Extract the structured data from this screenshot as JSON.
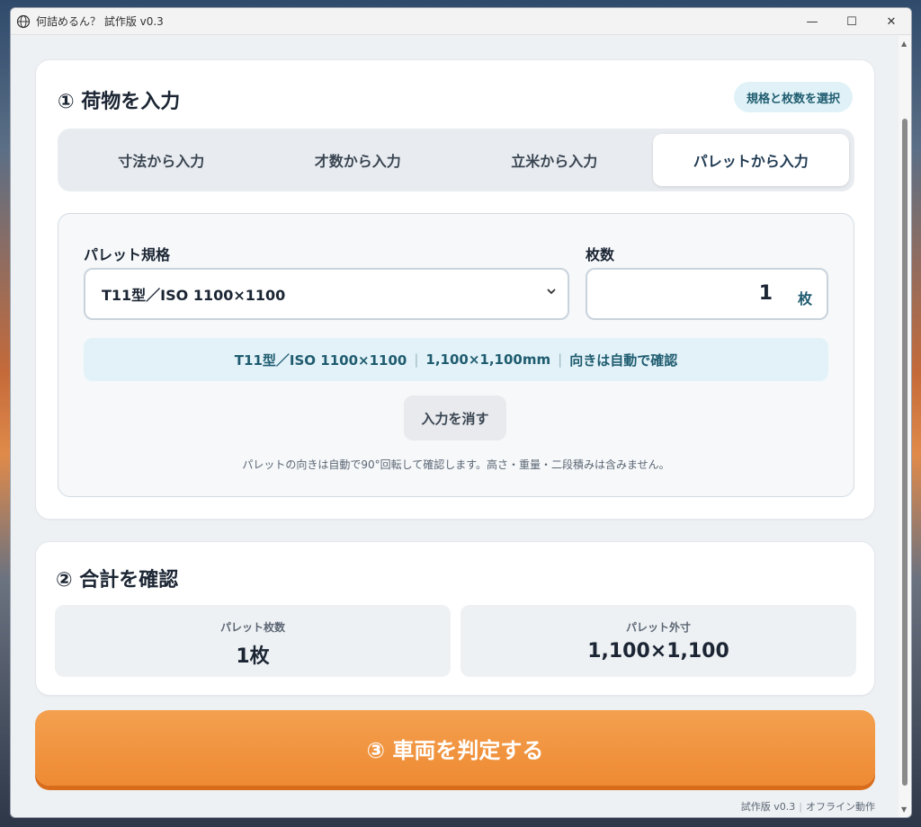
{
  "window": {
    "title": "何詰めるん？ 試作版 v0.3",
    "minimize": "—",
    "maximize": "☐",
    "close": "✕"
  },
  "section1": {
    "title": "① 荷物を入力",
    "chip": "規格と枚数を選択",
    "tabs": [
      {
        "label": "寸法から入力",
        "active": false
      },
      {
        "label": "才数から入力",
        "active": false
      },
      {
        "label": "立米から入力",
        "active": false
      },
      {
        "label": "パレットから入力",
        "active": true
      }
    ],
    "spec_label": "パレット規格",
    "spec_value": "T11型／ISO 1100×1100",
    "count_label": "枚数",
    "count_value": "1",
    "count_unit": "枚",
    "summary": {
      "part1": "T11型／ISO 1100×1100",
      "part2": "1,100×1,100mm",
      "part3": "向きは自動で確認"
    },
    "clear_button": "入力を消す",
    "note": "パレットの向きは自動で90°回転して確認します。高さ・重量・二段積みは含みません。"
  },
  "section2": {
    "title": "② 合計を確認",
    "stats": [
      {
        "label": "パレット枚数",
        "value": "1枚"
      },
      {
        "label": "パレット外寸",
        "value": "1,100×1,100"
      }
    ]
  },
  "judge_button": "③ 車両を判定する",
  "footer": {
    "version": "試作版 v0.3",
    "mode": "オフライン動作"
  },
  "colors": {
    "accent_orange": "#ee8a33",
    "teal_text": "#1f5c70",
    "chip_bg": "#e0f2f7"
  },
  "icons": {
    "app": "globe-icon",
    "dropdown": "chevron-down-icon"
  }
}
